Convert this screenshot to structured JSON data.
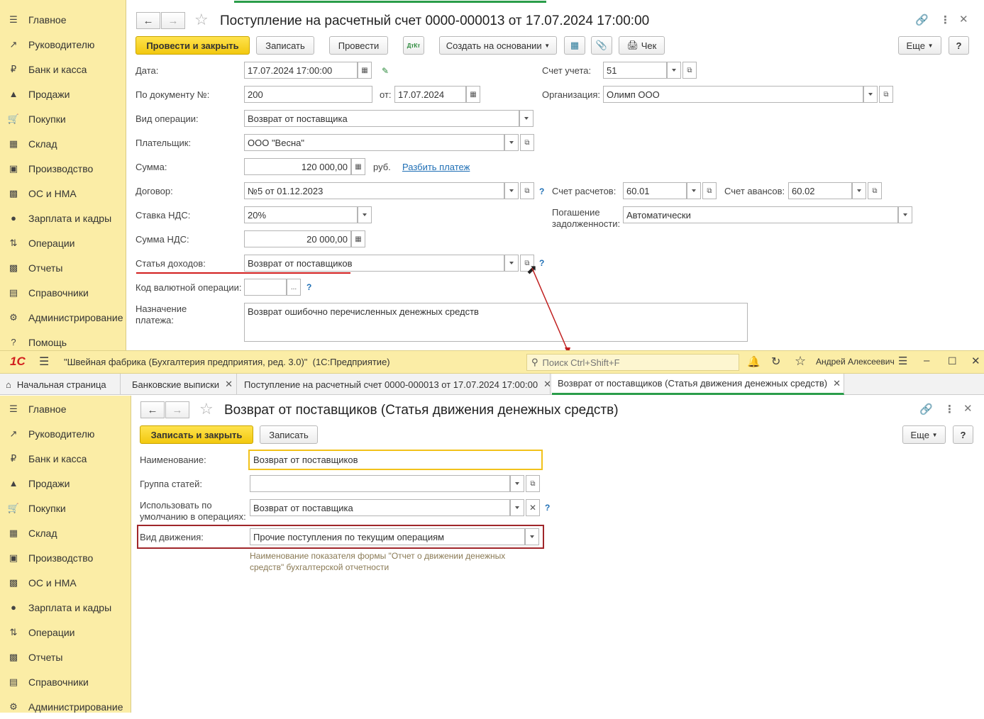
{
  "sidebar_items": [
    {
      "icon": "menu-icon",
      "label": "Главное"
    },
    {
      "icon": "trend-icon",
      "label": "Руководителю"
    },
    {
      "icon": "ruble-icon",
      "label": "Банк и касса"
    },
    {
      "icon": "bag-icon",
      "label": "Продажи"
    },
    {
      "icon": "cart-icon",
      "label": "Покупки"
    },
    {
      "icon": "warehouse-icon",
      "label": "Склад"
    },
    {
      "icon": "factory-icon",
      "label": "Производство"
    },
    {
      "icon": "truck-icon",
      "label": "ОС и НМА"
    },
    {
      "icon": "person-icon",
      "label": "Зарплата и кадры"
    },
    {
      "icon": "dtkt-icon",
      "label": "Операции"
    },
    {
      "icon": "bar-chart-icon",
      "label": "Отчеты"
    },
    {
      "icon": "books-icon",
      "label": "Справочники"
    },
    {
      "icon": "gear-icon",
      "label": "Администрирование"
    },
    {
      "icon": "help-icon",
      "label": "Помощь"
    }
  ],
  "doc": {
    "title": "Поступление на расчетный счет 0000-000013 от 17.07.2024 17:00:00",
    "btn_post_close": "Провести и закрыть",
    "btn_save": "Записать",
    "btn_post": "Провести",
    "btn_dtkt": "ДтКт",
    "btn_create_based": "Создать на основании",
    "btn_check": "Чек",
    "btn_more": "Еще",
    "btn_help": "?",
    "date_label": "Дата:",
    "date_value": "17.07.2024 17:00:00",
    "account_label": "Счет учета:",
    "account_value": "51",
    "docnum_label": "По документу №:",
    "docnum_value": "200",
    "from_label": "от:",
    "from_value": "17.07.2024",
    "org_label": "Организация:",
    "org_value": "Олимп ООО",
    "optype_label": "Вид операции:",
    "optype_value": "Возврат от поставщика",
    "payer_label": "Плательщик:",
    "payer_value": "ООО \"Весна\"",
    "sum_label": "Сумма:",
    "sum_value": "120 000,00",
    "currency": "руб.",
    "split_link": "Разбить платеж",
    "contract_label": "Договор:",
    "contract_value": "№5 от 01.12.2023",
    "settle_acc_label": "Счет расчетов:",
    "settle_acc_value": "60.01",
    "adv_acc_label": "Счет авансов:",
    "adv_acc_value": "60.02",
    "vat_rate_label": "Ставка НДС:",
    "vat_rate_value": "20%",
    "repay_label": "Погашение задолженности:",
    "repay_value": "Автоматически",
    "vat_sum_label": "Сумма НДС:",
    "vat_sum_value": "20 000,00",
    "income_label": "Статья доходов:",
    "income_value": "Возврат от поставщиков",
    "curr_op_label": "Код валютной операции:",
    "curr_op_value": "",
    "purpose_label": "Назначение платежа:",
    "purpose_value": "Возврат ошибочно перечисленных денежных средств",
    "q": "?",
    "ellipsis": "..."
  },
  "taskbar": {
    "logo": "1С",
    "app_title": "\"Швейная фабрика (Бухгалтерия предприятия, ред. 3.0)\"  (1С:Предприятие)",
    "search_placeholder": "Поиск Ctrl+Shift+F",
    "user": "Андрей Алексеевич"
  },
  "tabs": [
    {
      "label": "Начальная страница"
    },
    {
      "label": "Банковские выписки"
    },
    {
      "label": "Поступление на расчетный счет 0000-000013 от 17.07.2024 17:00:00"
    },
    {
      "label": "Возврат от поставщиков (Статья движения денежных средств)"
    }
  ],
  "item": {
    "title": "Возврат от поставщиков (Статья движения денежных средств)",
    "btn_save_close": "Записать и закрыть",
    "btn_save": "Записать",
    "btn_more": "Еще",
    "btn_help": "?",
    "name_label": "Наименование:",
    "name_value": "Возврат от поставщиков",
    "group_label": "Группа статей:",
    "group_value": "",
    "default_label": "Использовать по умолчанию в операциях:",
    "default_value": "Возврат от поставщика",
    "movement_label": "Вид движения:",
    "movement_value": "Прочие поступления по текущим операциям",
    "hint": "Наименование показателя формы \"Отчет о движении денежных средств\" бухгалтерской отчетности"
  },
  "colors": {
    "accent_yellow": "#f7d21c",
    "sidebar": "#fbeda6",
    "highlight_red": "#a0262a",
    "link": "#1f6fb5"
  }
}
